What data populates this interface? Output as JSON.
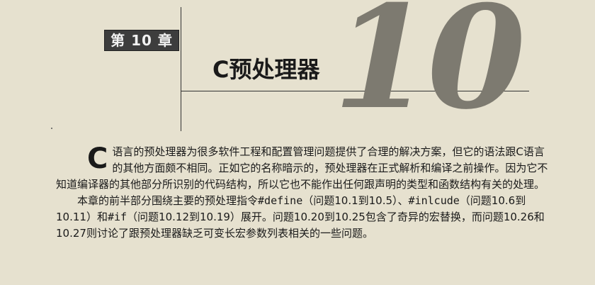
{
  "chapter_label": "第 10 章",
  "chapter_title": "C预处理器",
  "big_number": "10",
  "body": {
    "p1_dropcap": "C",
    "p1_rest": "语言的预处理器为很多软件工程和配置管理问题提供了合理的解决方案，但它的语法跟C语言的其他方面颇不相同。正如它的名称暗示的，预处理器在正式解析和编译之前操作。因为它不知道编译器的其他部分所识别的代码结构，所以它也不能作出任何跟声明的类型和函数结构有关的处理。",
    "p2_a": "本章的前半部分围绕主要的预处理指令",
    "p2_code1": "#define",
    "p2_b": "（问题10.1到10.5）、",
    "p2_code2": "#inlcude",
    "p2_c": "（问题10.6到10.11）和",
    "p2_code3": "#if",
    "p2_d": "（问题10.12到10.19）展开。问题10.20到10.25包含了奇异的宏替换，而问题10.26和10.27则讨论了跟预处理器缺乏可变长宏参数列表相关的一些问题。"
  }
}
